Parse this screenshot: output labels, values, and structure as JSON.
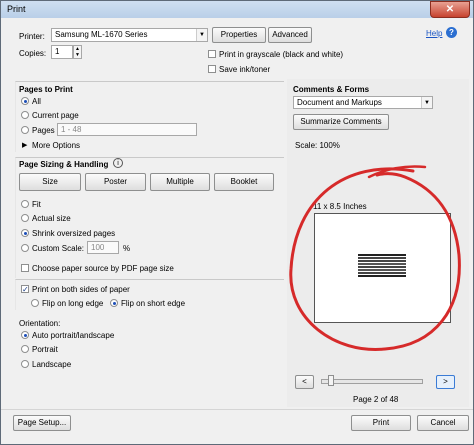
{
  "window": {
    "title": "Print",
    "close_glyph": "✕"
  },
  "printer": {
    "label": "Printer:",
    "selected": "Samsung ML-1670 Series",
    "properties_label": "Properties",
    "advanced_label": "Advanced",
    "help_label": "Help"
  },
  "copies": {
    "label": "Copies:",
    "value": "1"
  },
  "options": {
    "grayscale_label": "Print in grayscale (black and white)",
    "save_ink_label": "Save ink/toner"
  },
  "pages_to_print": {
    "heading": "Pages to Print",
    "all_label": "All",
    "current_label": "Current page",
    "pages_label": "Pages",
    "pages_placeholder": "1 - 48",
    "more_options_label": "More Options"
  },
  "sizing": {
    "heading": "Page Sizing & Handling",
    "tabs": [
      "Size",
      "Poster",
      "Multiple",
      "Booklet"
    ],
    "fit_label": "Fit",
    "actual_label": "Actual size",
    "shrink_label": "Shrink oversized pages",
    "custom_label": "Custom Scale:",
    "custom_value": "100",
    "custom_unit": "%",
    "pdf_size_label": "Choose paper source by PDF page size"
  },
  "duplex": {
    "both_sides_label": "Print on both sides of paper",
    "flip_long_label": "Flip on long edge",
    "flip_short_label": "Flip on short edge"
  },
  "orientation": {
    "heading": "Orientation:",
    "auto_label": "Auto portrait/landscape",
    "portrait_label": "Portrait",
    "landscape_label": "Landscape"
  },
  "comments": {
    "heading": "Comments & Forms",
    "selected": "Document and Markups",
    "summarize_label": "Summarize Comments",
    "scale_text": "Scale: 100%"
  },
  "preview": {
    "size_text": "11 x 8.5 Inches",
    "page_text": "Page 2 of 48",
    "prev_glyph": "<",
    "next_glyph": ">"
  },
  "footer": {
    "page_setup_label": "Page Setup...",
    "print_label": "Print",
    "cancel_label": "Cancel"
  },
  "icons": {
    "info": "info-icon",
    "chevron": "chevron-right-icon",
    "dropdown": "chevron-down-icon"
  }
}
